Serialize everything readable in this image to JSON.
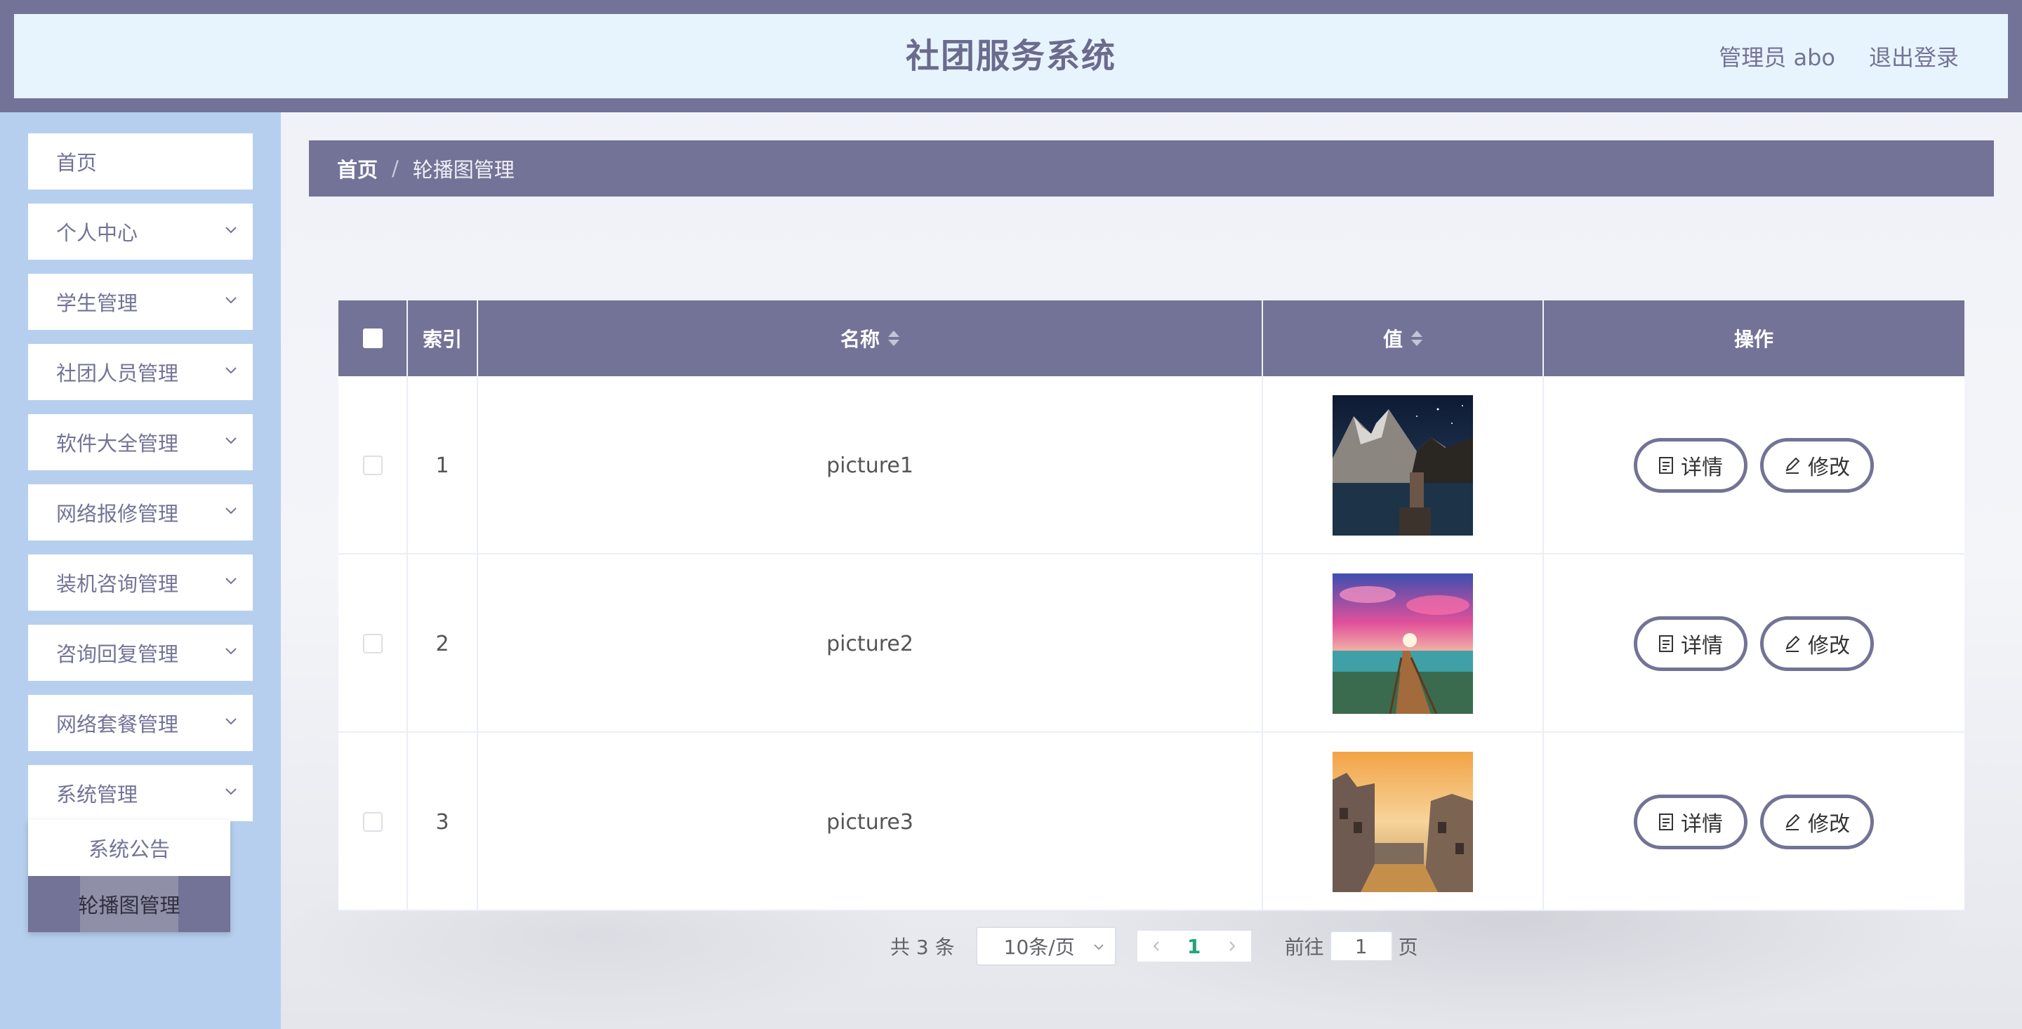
{
  "header": {
    "title": "社团服务系统",
    "user": "管理员 abo",
    "logout": "退出登录"
  },
  "sidebar": {
    "items": [
      {
        "label": "首页"
      },
      {
        "label": "个人中心"
      },
      {
        "label": "学生管理"
      },
      {
        "label": "社团人员管理"
      },
      {
        "label": "软件大全管理"
      },
      {
        "label": "网络报修管理"
      },
      {
        "label": "装机咨询管理"
      },
      {
        "label": "咨询回复管理"
      },
      {
        "label": "网络套餐管理"
      },
      {
        "label": "系统管理"
      }
    ],
    "submenu": [
      {
        "label": "系统公告"
      },
      {
        "label": "轮播图管理"
      }
    ]
  },
  "breadcrumb": {
    "home": "首页",
    "separator": "/",
    "current": "轮播图管理"
  },
  "table": {
    "columns": {
      "index": "索引",
      "name": "名称",
      "value": "值",
      "actions": "操作"
    },
    "rows": [
      {
        "index": "1",
        "name": "picture1",
        "detail": "详情",
        "edit": "修改",
        "image": "mountain-lake-night"
      },
      {
        "index": "2",
        "name": "picture2",
        "detail": "详情",
        "edit": "修改",
        "image": "sunset-boardwalk"
      },
      {
        "index": "3",
        "name": "picture3",
        "detail": "详情",
        "edit": "修改",
        "image": "canal-town-dusk"
      }
    ]
  },
  "pagination": {
    "total": "共 3 条",
    "page_size": "10条/页",
    "current_page": "1",
    "goto_label": "前往",
    "goto_value": "1",
    "page_suffix": "页"
  },
  "colors": {
    "primary": "#737397",
    "header_bg": "#e8f4fd",
    "sidebar_bg": "#b7cfee",
    "active_page": "#1fa37a"
  }
}
